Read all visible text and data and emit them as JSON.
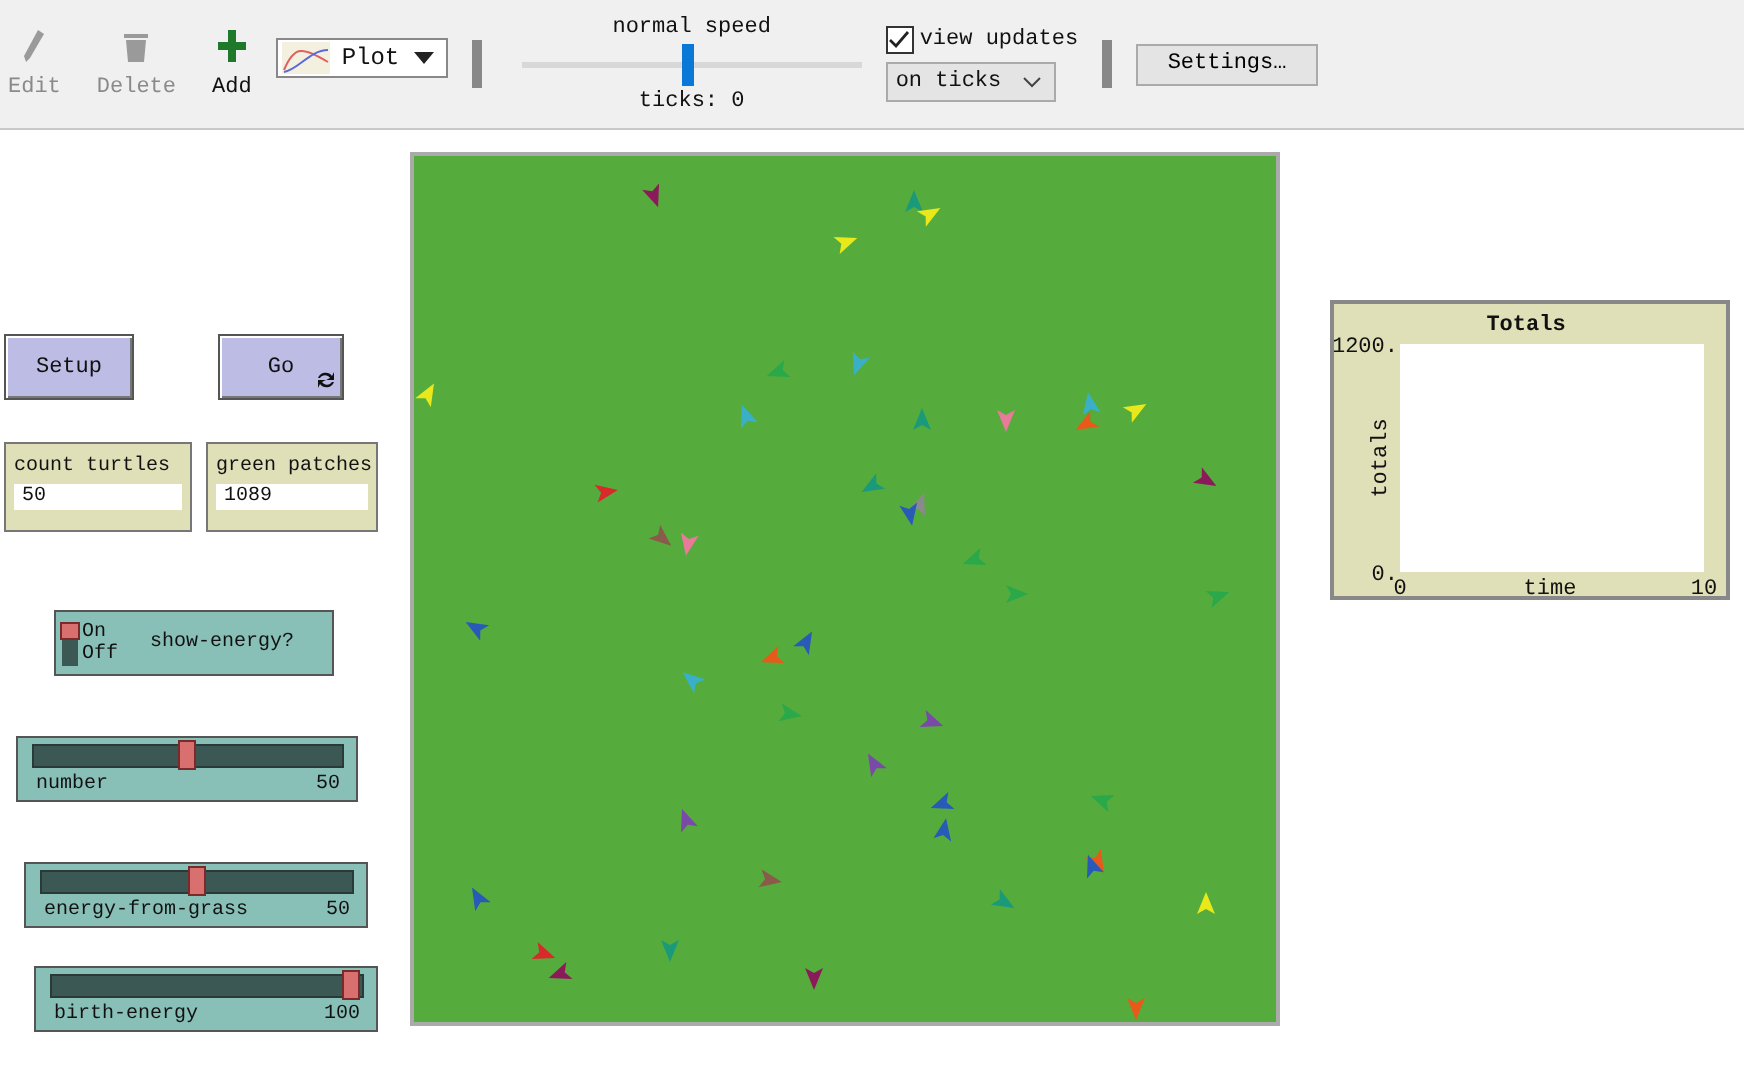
{
  "toolbar": {
    "tools": [
      {
        "label": "Edit",
        "kind": "edit",
        "disabled": true
      },
      {
        "label": "Delete",
        "kind": "delete",
        "disabled": true
      },
      {
        "label": "Add",
        "kind": "add",
        "disabled": false
      }
    ],
    "widget_type": "Plot",
    "speed": {
      "label": "normal speed",
      "level": 0.49
    },
    "ticks": "ticks: 0",
    "view_updates": {
      "label": "view updates",
      "checked": true
    },
    "update_mode": "on ticks",
    "settings": "Settings…"
  },
  "buttons": [
    {
      "label": "Setup",
      "forever": false
    },
    {
      "label": "Go",
      "forever": true
    }
  ],
  "monitors": [
    {
      "label": "count turtles",
      "value": "50"
    },
    {
      "label": "green patches",
      "value": "1089"
    }
  ],
  "switch": {
    "label": "show-energy?",
    "on_label": "On",
    "off_label": "Off",
    "on": true
  },
  "sliders": [
    {
      "label": "number",
      "value": "50",
      "level": 0.5
    },
    {
      "label": "energy-from-grass",
      "value": "50",
      "level": 0.5
    },
    {
      "label": "birth-energy",
      "value": "100",
      "level": 1
    }
  ],
  "plot": {
    "chart_data": {
      "type": "line",
      "title": "Totals",
      "xlabel": "time",
      "ylabel": "totals",
      "xlim": [
        0,
        10
      ],
      "ylim": [
        0,
        1200
      ],
      "xticks": [
        0,
        10
      ],
      "yticks": [
        {
          "value": 0,
          "label": "0."
        },
        {
          "value": 1200,
          "label": "1200."
        }
      ]
    }
  }
}
